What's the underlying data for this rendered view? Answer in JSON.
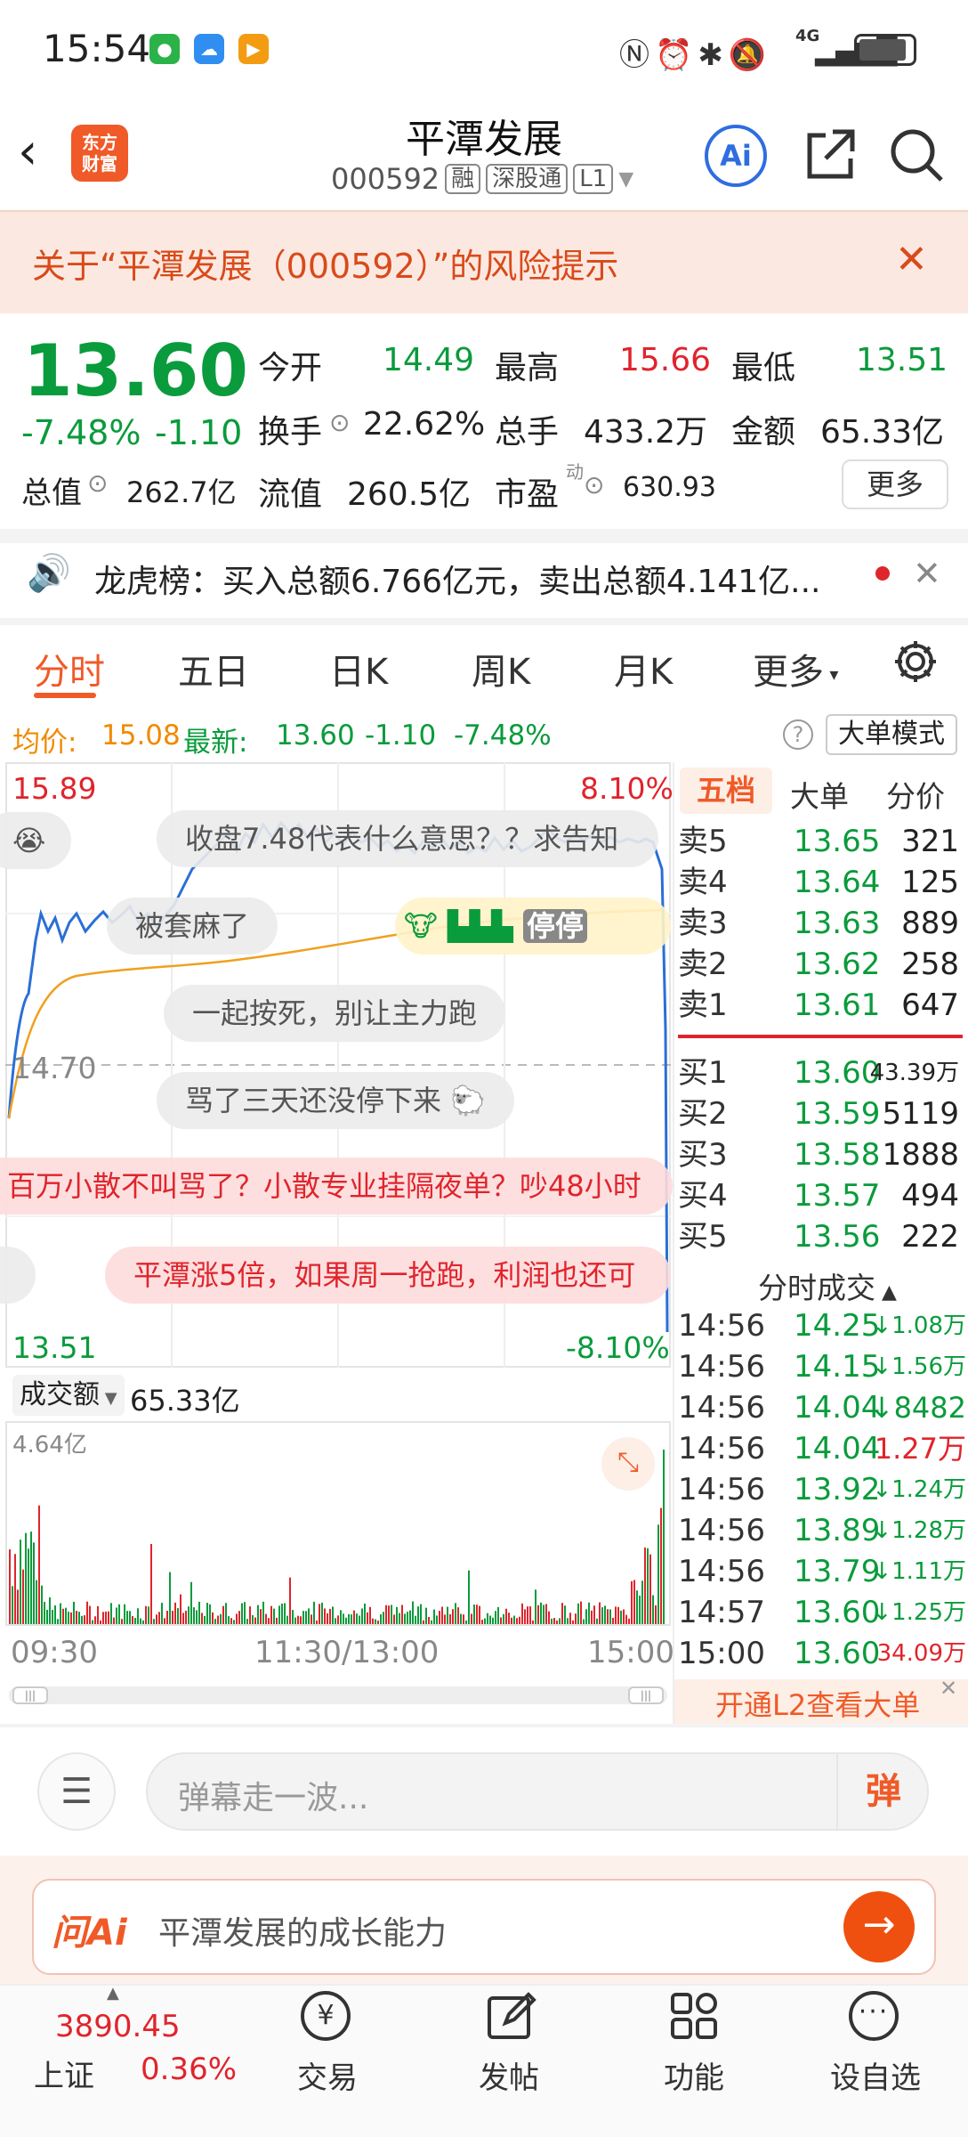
{
  "status_bar": {
    "time": "15:54",
    "network": "4G"
  },
  "header": {
    "logo_text": "东方财富",
    "title": "平潭发展",
    "code": "000592",
    "tags": [
      "融",
      "深股通",
      "L1"
    ],
    "ai_label": "Ai"
  },
  "risk_banner": {
    "text": "关于“平潭发展（000592）”的风险提示"
  },
  "quote": {
    "price": "13.60",
    "change_pct": "-7.48%",
    "change": "-1.10",
    "open_label": "今开",
    "open": "14.49",
    "high_label": "最高",
    "high": "15.66",
    "low_label": "最低",
    "low": "13.51",
    "turnover_label": "换手",
    "turnover": "22.62%",
    "volume_label": "总手",
    "volume": "433.2万",
    "amount_label": "金额",
    "amount": "65.33亿",
    "mktcap_label": "总值",
    "mktcap": "262.7亿",
    "float_label": "流值",
    "float": "260.5亿",
    "pe_label": "市盈",
    "pe_sup": "动",
    "pe": "630.93",
    "more_label": "更多"
  },
  "dragon_tiger": {
    "text": "龙虎榜：买入总额6.766亿元，卖出总额4.141亿..."
  },
  "tabs": [
    "分时",
    "五日",
    "日K",
    "周K",
    "月K",
    "更多"
  ],
  "info_row": {
    "avg_label": "均价:",
    "avg": "15.08",
    "latest_label": "最新:",
    "latest": "13.60",
    "chg": "-1.10",
    "pct": "-7.48%",
    "big_order_mode": "大单模式"
  },
  "chart": {
    "top_price": "15.89",
    "top_pct": "8.10%",
    "mid_price": "14.70",
    "bottom_price": "13.51",
    "bottom_pct": "-8.10%",
    "time_labels": [
      "09:30",
      "11:30/13:00",
      "15:00"
    ],
    "vol_selector": "成交额",
    "vol_total": "65.33亿",
    "vol_max": "4.64亿"
  },
  "danmaku": [
    "收盘7.48代表什么意思？？求告知",
    "被套麻了",
    "一起按死，别让主力跑",
    "骂了三天还没停下来",
    "百万小散不叫骂了？小散专业挂隔夜单？吵48小时",
    "平潭涨5倍，如果周一抢跑，利润也还可"
  ],
  "danmaku_emoji_text": "停停",
  "orderbook": {
    "tabs": [
      "五档",
      "大单",
      "分价"
    ],
    "asks": [
      {
        "label": "卖5",
        "price": "13.65",
        "vol": "321"
      },
      {
        "label": "卖4",
        "price": "13.64",
        "vol": "125"
      },
      {
        "label": "卖3",
        "price": "13.63",
        "vol": "889"
      },
      {
        "label": "卖2",
        "price": "13.62",
        "vol": "258"
      },
      {
        "label": "卖1",
        "price": "13.61",
        "vol": "647"
      }
    ],
    "bids": [
      {
        "label": "买1",
        "price": "13.60",
        "vol": "43.39万"
      },
      {
        "label": "买2",
        "price": "13.59",
        "vol": "5119"
      },
      {
        "label": "买3",
        "price": "13.58",
        "vol": "1888"
      },
      {
        "label": "买4",
        "price": "13.57",
        "vol": "494"
      },
      {
        "label": "买5",
        "price": "13.56",
        "vol": "222"
      }
    ],
    "ticks_title": "分时成交",
    "ticks": [
      {
        "time": "14:56",
        "price": "14.25",
        "vol": "↓1.08万"
      },
      {
        "time": "14:56",
        "price": "14.15",
        "vol": "↓1.56万"
      },
      {
        "time": "14:56",
        "price": "14.04",
        "vol": "↓8482"
      },
      {
        "time": "14:56",
        "price": "14.04",
        "vol": "1.27万"
      },
      {
        "time": "14:56",
        "price": "13.92",
        "vol": "↓1.24万"
      },
      {
        "time": "14:56",
        "price": "13.89",
        "vol": "↓1.28万"
      },
      {
        "time": "14:56",
        "price": "13.79",
        "vol": "↓1.11万"
      },
      {
        "time": "14:57",
        "price": "13.60",
        "vol": "↓1.25万"
      },
      {
        "time": "15:00",
        "price": "13.60",
        "vol": "34.09万"
      }
    ],
    "l2_promo": "开通L2查看大单"
  },
  "comment_bar": {
    "placeholder": "弹幕走一波...",
    "send_label": "弹"
  },
  "ai_bar": {
    "brand": "问Ai",
    "query": "平潭发展的成长能力"
  },
  "bottom_nav": {
    "index_value": "3890.45",
    "index_name": "上证",
    "index_pct": "0.36%",
    "items": [
      "交易",
      "发帖",
      "功能",
      "设自选"
    ]
  },
  "colors": {
    "up": "#e0242c",
    "down": "#0a9b3c",
    "accent": "#f05a28",
    "avg_line": "#f0a020",
    "price_line": "#2a6fd6"
  }
}
